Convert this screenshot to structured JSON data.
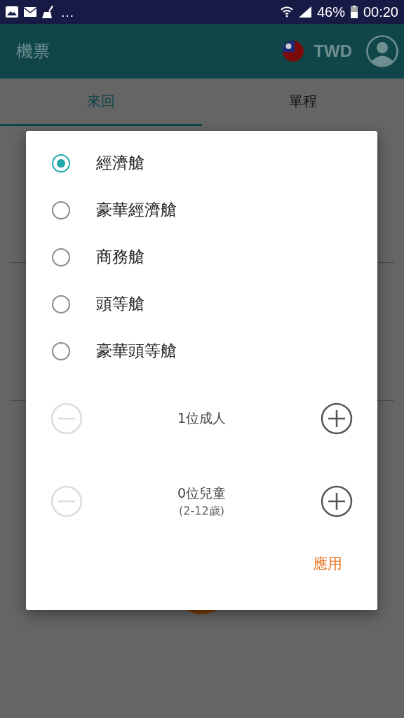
{
  "status_bar": {
    "more": "…",
    "battery_text": "46%",
    "time": "00:20"
  },
  "app_bar": {
    "title": "機票",
    "currency": "TWD"
  },
  "tabs": [
    {
      "label": "來回",
      "selected": true
    },
    {
      "label": "單程",
      "selected": false
    }
  ],
  "dialog": {
    "cabin_options": [
      {
        "label": "經濟艙",
        "selected": true
      },
      {
        "label": "豪華經濟艙",
        "selected": false
      },
      {
        "label": "商務艙",
        "selected": false
      },
      {
        "label": "頭等艙",
        "selected": false
      },
      {
        "label": "豪華頭等艙",
        "selected": false
      }
    ],
    "passengers": [
      {
        "label": "1位成人",
        "decrease_disabled": true,
        "increase_disabled": false
      },
      {
        "label": "0位兒童",
        "note": "(2-12歲)",
        "decrease_disabled": true,
        "increase_disabled": false
      }
    ],
    "apply_button": "應用"
  }
}
